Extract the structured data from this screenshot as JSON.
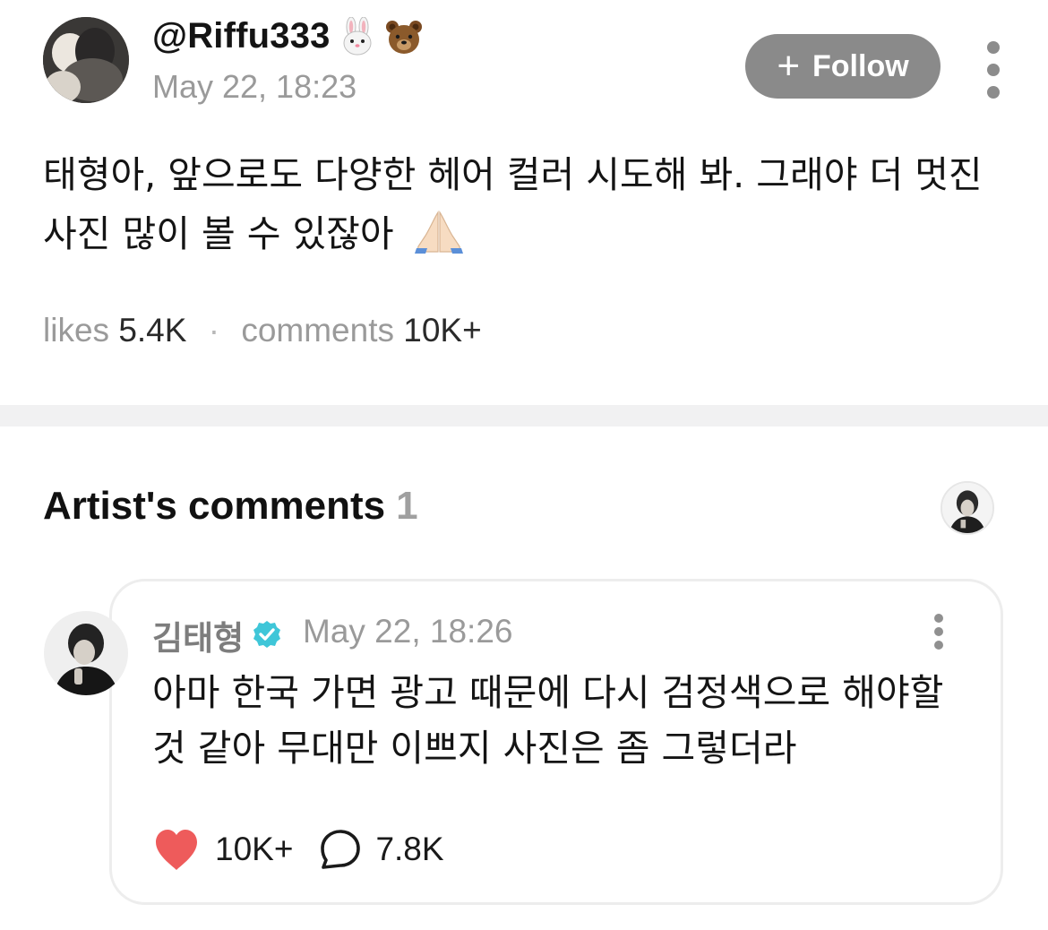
{
  "post": {
    "username": "@Riffu333",
    "username_emojis": [
      "rabbit-face-icon",
      "bear-face-icon"
    ],
    "timestamp": "May 22, 18:23",
    "follow_label": "Follow",
    "body_text": "태형아, 앞으로도 다양한 헤어 컬러 시도해 봐. 그래야 더 멋진 사진 많이 볼 수 있잖아",
    "body_emoji": "folded-hands-icon",
    "stats": {
      "likes_label": "likes",
      "likes_value": "5.4K",
      "separator": "·",
      "comments_label": "comments",
      "comments_value": "10K+"
    }
  },
  "artist_comments": {
    "title": "Artist's comments",
    "count": "1",
    "comment": {
      "author": "김태형",
      "verified": true,
      "timestamp": "May 22, 18:26",
      "body_text": "아마 한국 가면 광고 때문에 다시 검정색으로 해야할 것 같아 무대만 이쁘지 사진은 좀 그렇더라",
      "likes": "10K+",
      "replies": "7.8K"
    }
  },
  "colors": {
    "follow_button": "#8a8a8a",
    "verified_badge": "#3fc6d8",
    "heart": "#ee5b5b",
    "muted_text": "#9a9a9a",
    "divider": "#f1f1f2"
  }
}
